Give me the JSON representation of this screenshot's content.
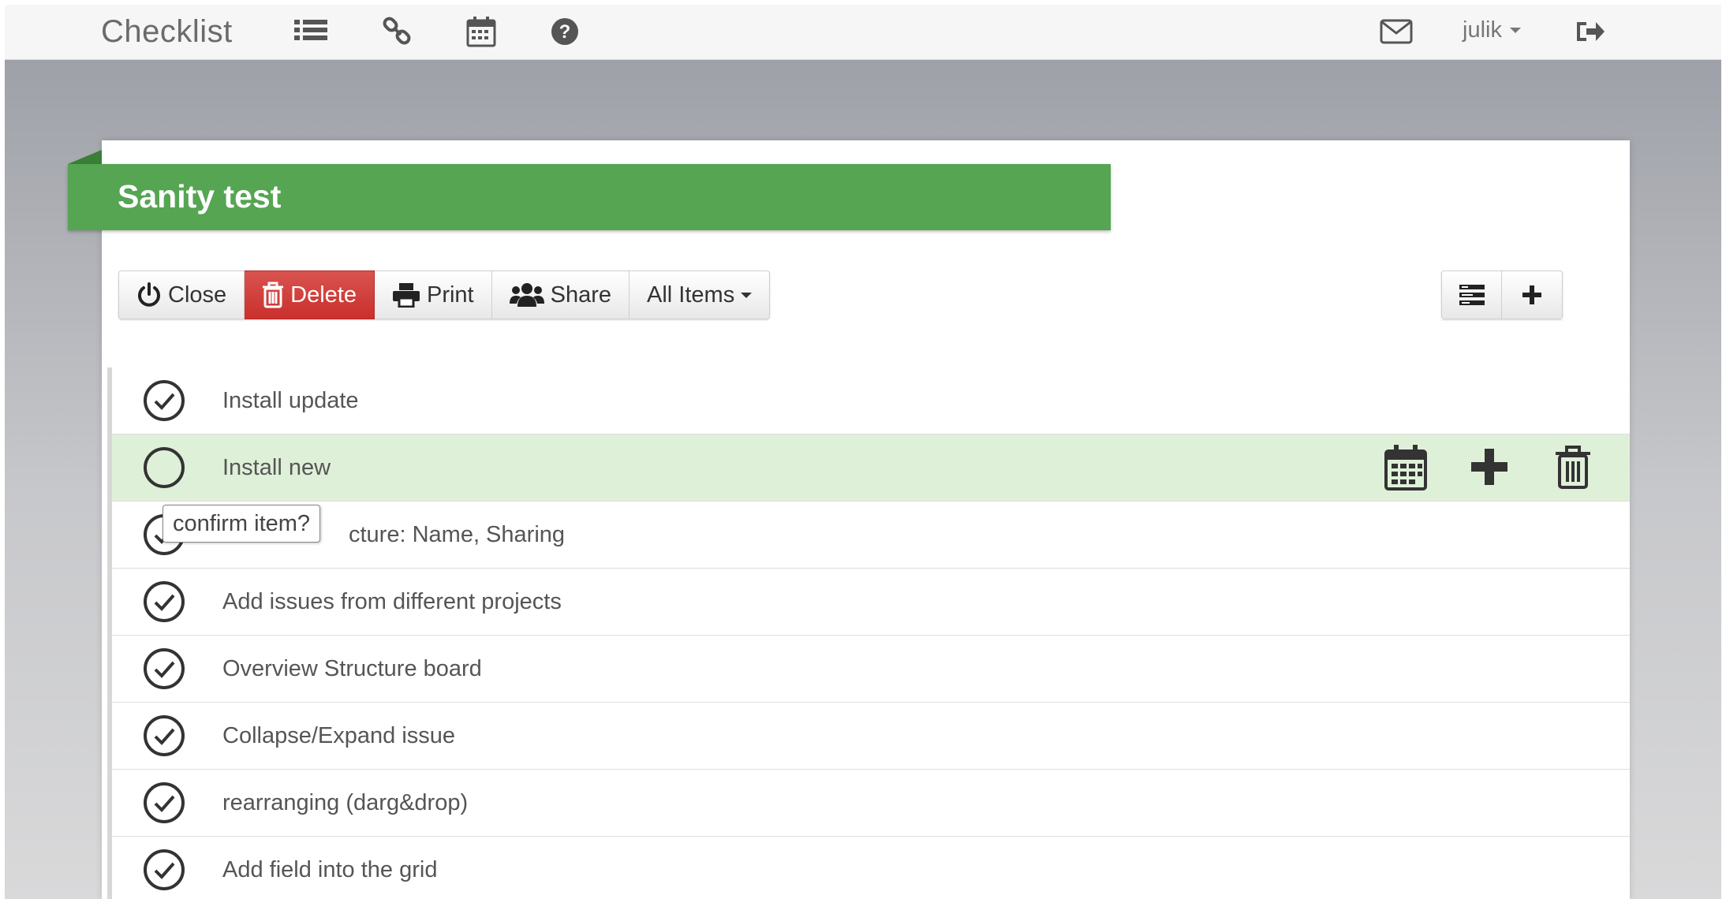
{
  "navbar": {
    "brand": "Checklist",
    "icons": [
      "list-icon",
      "link-icon",
      "calendar-icon",
      "help-icon"
    ],
    "mail_icon": "envelope-icon",
    "user": "julik",
    "logout_icon": "sign-out-icon"
  },
  "checklist": {
    "title": "Sanity test"
  },
  "toolbar": {
    "close_label": "Close",
    "delete_label": "Delete",
    "print_label": "Print",
    "share_label": "Share",
    "filter_label": "All Items"
  },
  "items": [
    {
      "label": "Install update",
      "done": true
    },
    {
      "label": "Install new",
      "done": false,
      "active": true
    },
    {
      "label": "cture: Name, Sharing",
      "done": true
    },
    {
      "label": "Add issues from different projects",
      "done": true
    },
    {
      "label": "Overview Structure board",
      "done": true
    },
    {
      "label": "Collapse/Expand issue",
      "done": true
    },
    {
      "label": "rearranging (darg&drop)",
      "done": true
    },
    {
      "label": "Add field into the grid",
      "done": true
    }
  ],
  "tooltip": "confirm item?",
  "colors": {
    "ribbon": "#55a552",
    "danger": "#d9534f",
    "active_row": "#dff0d8"
  }
}
